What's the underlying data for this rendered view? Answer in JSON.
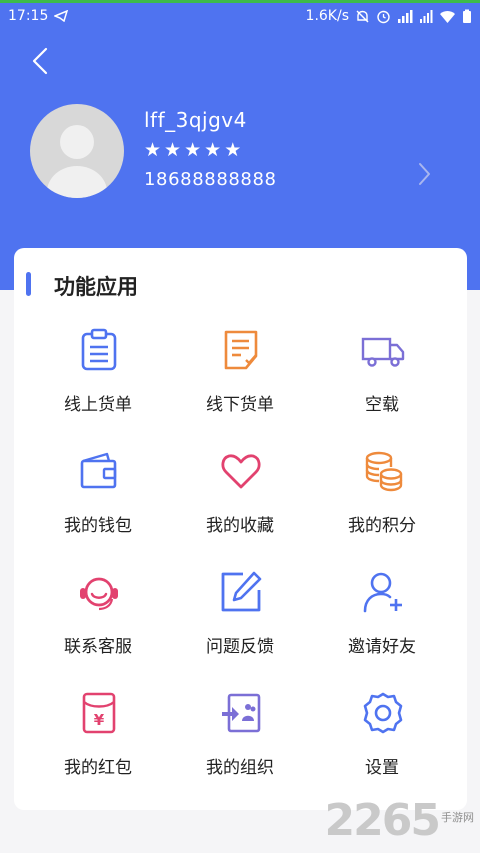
{
  "status_bar": {
    "time": "17:15",
    "network_speed": "1.6K/s",
    "icons": [
      "telegram-icon",
      "mute-icon",
      "alarm-icon",
      "hd-signal-icon",
      "signal-icon",
      "wifi-icon",
      "battery-icon"
    ]
  },
  "colors": {
    "header": "#4f73f0",
    "accent": "#4f73f0",
    "orange": "#ee8a3c",
    "pink": "#e2426f",
    "purple": "#7b6fd6"
  },
  "profile": {
    "username": "lff_3qjgv4",
    "stars": [
      "★",
      "★",
      "★",
      "★",
      "★"
    ],
    "star_rating": 5,
    "phone": "18688888888"
  },
  "panel": {
    "title": "功能应用",
    "items": [
      {
        "label": "线上货单",
        "icon": "clipboard-list-icon"
      },
      {
        "label": "线下货单",
        "icon": "document-check-icon"
      },
      {
        "label": "空载",
        "icon": "truck-icon"
      },
      {
        "label": "我的钱包",
        "icon": "wallet-icon"
      },
      {
        "label": "我的收藏",
        "icon": "heart-icon"
      },
      {
        "label": "我的积分",
        "icon": "coins-icon"
      },
      {
        "label": "联系客服",
        "icon": "headset-icon"
      },
      {
        "label": "问题反馈",
        "icon": "edit-icon"
      },
      {
        "label": "邀请好友",
        "icon": "add-user-icon"
      },
      {
        "label": "我的红包",
        "icon": "red-envelope-icon"
      },
      {
        "label": "我的组织",
        "icon": "organization-icon"
      },
      {
        "label": "设置",
        "icon": "settings-gear-icon"
      }
    ]
  },
  "watermark": {
    "number": "2265",
    "text": "手游网"
  }
}
